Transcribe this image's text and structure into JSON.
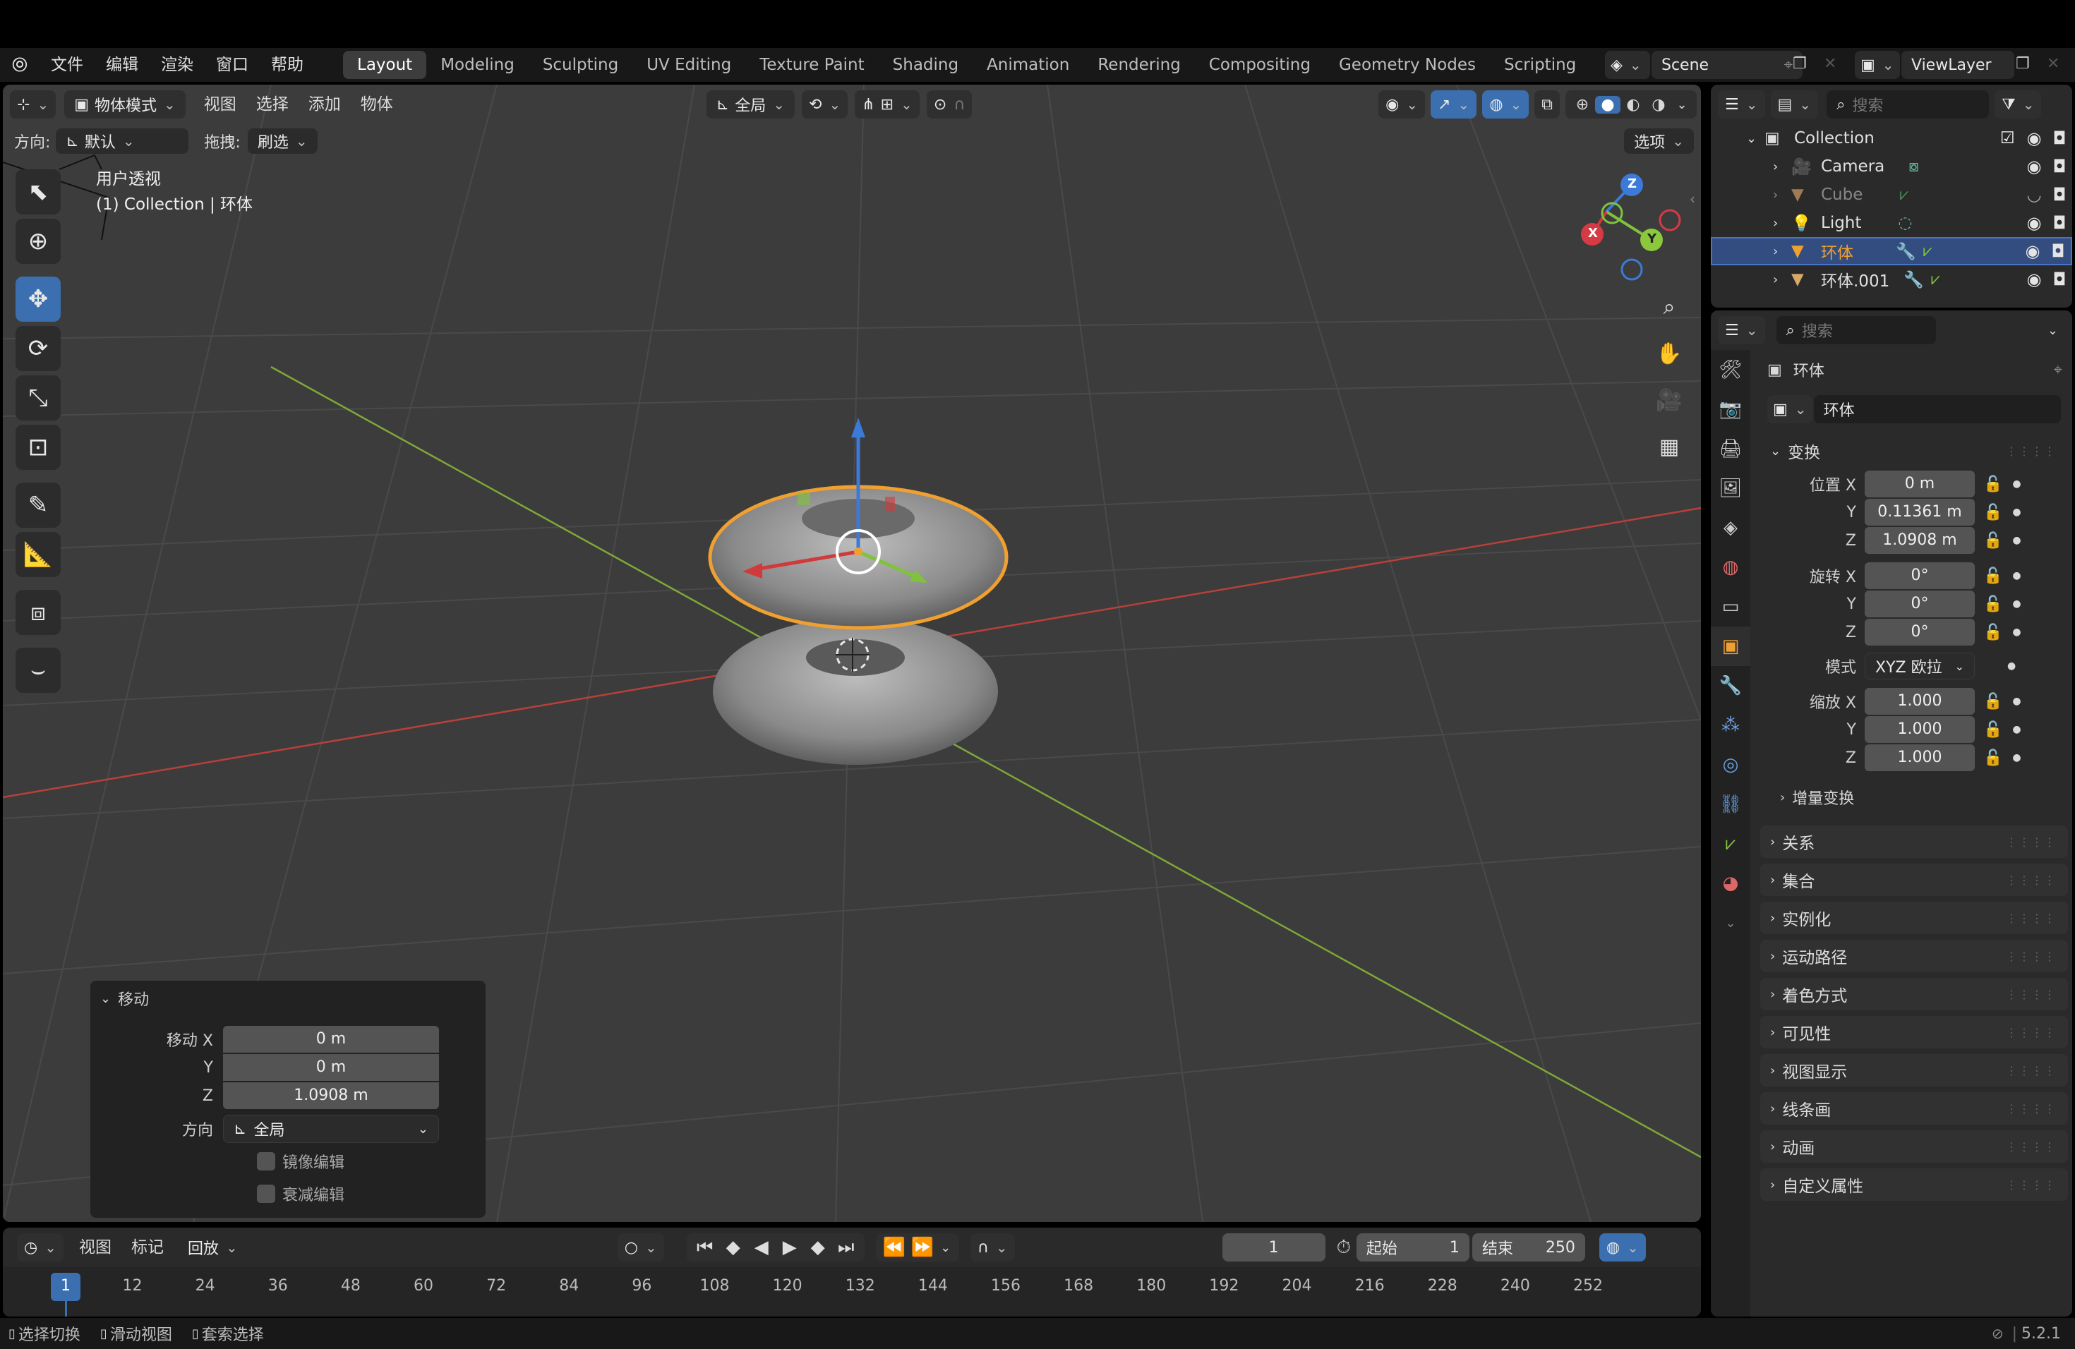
{
  "topbar": {
    "menus": [
      "文件",
      "编辑",
      "渲染",
      "窗口",
      "帮助"
    ],
    "workspaces": [
      "Layout",
      "Modeling",
      "Sculpting",
      "UV Editing",
      "Texture Paint",
      "Shading",
      "Animation",
      "Rendering",
      "Compositing",
      "Geometry Nodes",
      "Scripting"
    ],
    "active_workspace": "Layout",
    "add_tab": "+",
    "scene": "Scene",
    "view_layer": "ViewLayer"
  },
  "viewport_header": {
    "mode": "物体模式",
    "menus": [
      "视图",
      "选择",
      "添加",
      "物体"
    ],
    "transform_orientation": "全局"
  },
  "tool_settings": {
    "orientation_label": "方向:",
    "orientation_value": "默认",
    "drag_label": "拖拽:",
    "drag_value": "刷选",
    "options": "选项"
  },
  "viewport": {
    "view_name": "用户透视",
    "context": "(1) Collection | 环体",
    "gizmo": {
      "x": "X",
      "y": "Y",
      "z": "Z"
    }
  },
  "operator_panel": {
    "title": "移动",
    "move_x_label": "移动 X",
    "move_x": "0 m",
    "move_y_label": "Y",
    "move_y": "0 m",
    "move_z_label": "Z",
    "move_z": "1.0908 m",
    "orientation_label": "方向",
    "orientation_value": "全局",
    "mirror": "镜像编辑",
    "proportional": "衰减编辑"
  },
  "outliner": {
    "search_placeholder": "搜索",
    "collection": "Collection",
    "items": [
      {
        "name": "Camera"
      },
      {
        "name": "Cube"
      },
      {
        "name": "Light"
      },
      {
        "name": "环体"
      },
      {
        "name": "环体.001"
      }
    ]
  },
  "properties": {
    "search_placeholder": "搜索",
    "object_name": "环体",
    "object_field": "环体",
    "transform_title": "变换",
    "location_label": "位置 X",
    "loc_x": "0 m",
    "loc_y": "0.11361 m",
    "loc_z": "1.0908 m",
    "rotation_label": "旋转 X",
    "rot_x": "0°",
    "rot_y": "0°",
    "rot_z": "0°",
    "mode_label": "模式",
    "mode_value": "XYZ 欧拉",
    "scale_label": "缩放 X",
    "scale_x": "1.000",
    "scale_y": "1.000",
    "scale_z": "1.000",
    "y_label": "Y",
    "z_label": "Z",
    "delta_transform": "增量变换",
    "panels": [
      "关系",
      "集合",
      "实例化",
      "运动路径",
      "着色方式",
      "可见性",
      "视图显示",
      "线条画",
      "动画",
      "自定义属性"
    ]
  },
  "timeline": {
    "menus": [
      "视图",
      "标记"
    ],
    "playback": "回放",
    "current_frame": "1",
    "start_label": "起始",
    "start": "1",
    "end_label": "结束",
    "end": "250",
    "ticks": [
      "1",
      "12",
      "24",
      "36",
      "48",
      "60",
      "72",
      "84",
      "96",
      "108",
      "120",
      "132",
      "144",
      "156",
      "168",
      "180",
      "192",
      "204",
      "216",
      "228",
      "240",
      "252"
    ]
  },
  "statusbar": {
    "items": [
      "选择切换",
      "滑动视图",
      "套索选择"
    ],
    "version": "5.2.1"
  },
  "colors": {
    "selection_outline": "#f0a030",
    "accent_blue": "#3b6fb0",
    "x_axis": "#c8413b",
    "y_axis": "#7fb83a",
    "z_axis": "#3c7ad8"
  }
}
